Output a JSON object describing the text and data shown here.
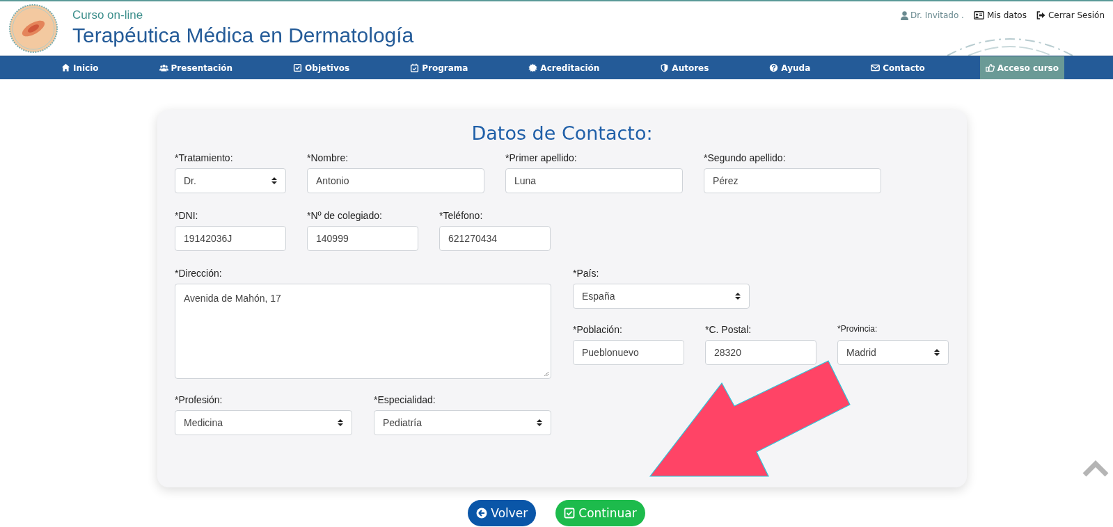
{
  "header": {
    "subtitle": "Curso on-line",
    "title": "Terapéutica Médica en Dermatología",
    "user": "Dr. Invitado .",
    "links": [
      "Mis datos",
      "Cerrar Sesión"
    ]
  },
  "nav": [
    {
      "label": "Inicio",
      "selected": false
    },
    {
      "label": "Presentación",
      "selected": false
    },
    {
      "label": "Objetivos",
      "selected": false
    },
    {
      "label": "Programa",
      "selected": false
    },
    {
      "label": "Acreditación",
      "selected": false
    },
    {
      "label": "Autores",
      "selected": false
    },
    {
      "label": "Ayuda",
      "selected": false
    },
    {
      "label": "Contacto",
      "selected": false
    },
    {
      "label": "Acceso curso",
      "selected": true
    }
  ],
  "form": {
    "title": "Datos de Contacto:",
    "personal": [
      {
        "label": "*Tratamiento:",
        "value": "Dr.",
        "kind": "select"
      },
      {
        "label": "*Nombre:",
        "value": "Antonio",
        "kind": "text"
      },
      {
        "label": "*Primer apellido:",
        "value": "Luna",
        "kind": "text"
      },
      {
        "label": "*Segundo apellido:",
        "value": "Pérez",
        "kind": "text"
      }
    ],
    "ids": [
      {
        "label": "*DNI:",
        "value": "19142036J",
        "kind": "text"
      },
      {
        "label": "*Nº de colegiado:",
        "value": "140999",
        "kind": "text"
      },
      {
        "label": "*Teléfono:",
        "value": "621270434",
        "kind": "text"
      }
    ],
    "address": {
      "label": "*Dirección:",
      "value": "Avenida de Mahón, 17",
      "kind": "textarea"
    },
    "country": {
      "label": "*País:",
      "value": "España",
      "kind": "select"
    },
    "locality": [
      {
        "label": "*Población:",
        "value": "Pueblonuevo",
        "kind": "text"
      },
      {
        "label": "*C. Postal:",
        "value": "28320",
        "kind": "text"
      },
      {
        "label": "*Provincia:",
        "value": "Madrid",
        "kind": "select"
      }
    ],
    "profession": [
      {
        "label": "*Profesión:",
        "value": "Medicina",
        "kind": "select"
      },
      {
        "label": "*Especialidad:",
        "value": "Pediatría",
        "kind": "select"
      }
    ]
  },
  "buttons": [
    "Volver",
    "Continuar"
  ]
}
